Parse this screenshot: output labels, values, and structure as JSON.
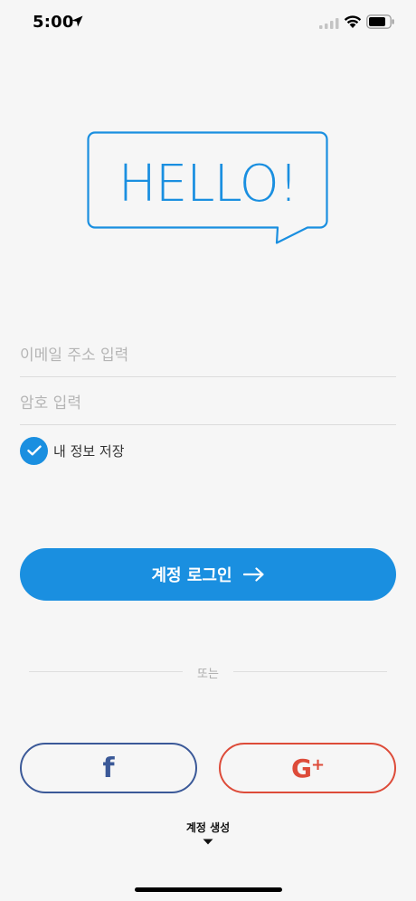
{
  "status_bar": {
    "time": "5:00",
    "icons": [
      "location-arrow-icon",
      "cellular-signal-icon",
      "wifi-icon",
      "battery-icon"
    ]
  },
  "logo": {
    "text": "HELLO!"
  },
  "form": {
    "email": {
      "placeholder": "이메일 주소 입력",
      "value": ""
    },
    "password": {
      "placeholder": "암호 입력",
      "value": ""
    },
    "remember": {
      "label": "내 정보 저장",
      "checked": true
    }
  },
  "login": {
    "label": "계정 로그인",
    "icon": "arrow-right-icon"
  },
  "divider": {
    "label": "또는"
  },
  "social": {
    "facebook": {
      "glyph": "f"
    },
    "google": {
      "glyph": "G",
      "plus": "+"
    }
  },
  "create_account": {
    "label": "계정 생성",
    "icon": "caret-down-icon"
  },
  "colors": {
    "accent": "#1a8fe0",
    "facebook": "#3b5998",
    "google": "#dd4b39",
    "background": "#f6f6f6"
  }
}
